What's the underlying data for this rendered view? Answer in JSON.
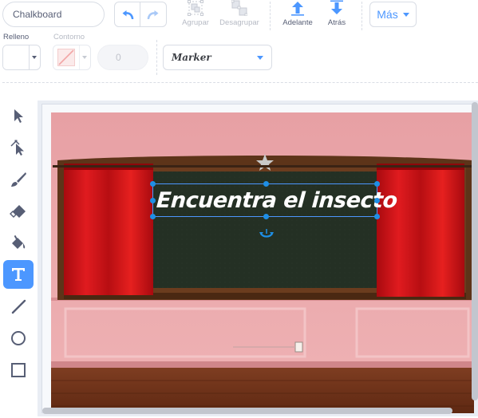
{
  "costume_name": "Chalkboard",
  "toolbar": {
    "undo_icon": "undo-arrow-icon",
    "redo_icon": "redo-arrow-icon",
    "group_label": "Agrupar",
    "ungroup_label": "Desagrupar",
    "forward_label": "Adelante",
    "backward_label": "Atrás",
    "more_label": "Más"
  },
  "fill": {
    "label": "Relleno",
    "color": "#ffffff"
  },
  "outline": {
    "label": "Contorno",
    "size_value": "0"
  },
  "font_select": {
    "value": "Marker"
  },
  "tools": [
    {
      "name": "select",
      "icon": "select-arrow-icon"
    },
    {
      "name": "reshape",
      "icon": "reshape-icon"
    },
    {
      "name": "brush",
      "icon": "brush-icon"
    },
    {
      "name": "eraser",
      "icon": "eraser-icon"
    },
    {
      "name": "fill",
      "icon": "fill-bucket-icon"
    },
    {
      "name": "text",
      "icon": "text-T-icon",
      "active": true
    },
    {
      "name": "line",
      "icon": "line-icon"
    },
    {
      "name": "circle",
      "icon": "circle-icon"
    },
    {
      "name": "rectangle",
      "icon": "rectangle-icon"
    }
  ],
  "canvas": {
    "text_content": "Encuentra el insecto"
  },
  "colors": {
    "accent": "#4c97ff",
    "text_gray": "#575e75",
    "disabled_gray": "#b6bac4",
    "selection": "#1e8fe6"
  }
}
